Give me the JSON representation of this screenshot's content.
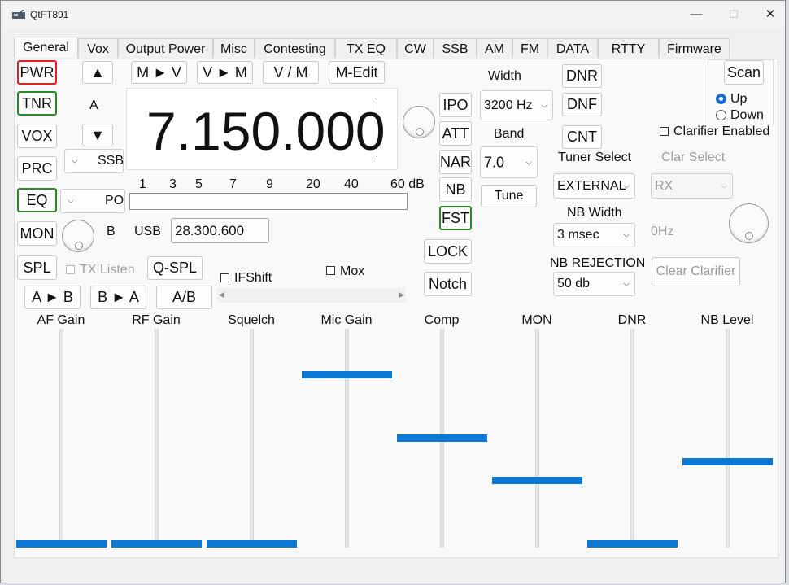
{
  "window": {
    "title": "QtFT891",
    "minimize": "—",
    "maximize": "☐",
    "close": "✕"
  },
  "tabs": [
    "General",
    "Vox",
    "Output Power",
    "Misc",
    "Contesting",
    "TX EQ",
    "CW",
    "SSB",
    "AM",
    "FM",
    "DATA",
    "RTTY",
    "Firmware"
  ],
  "active_tab": "General",
  "left_buttons": {
    "pwr": "PWR",
    "tnr": "TNR",
    "vox": "VOX",
    "prc": "PRC",
    "eq": "EQ",
    "mon": "MON",
    "spl": "SPL"
  },
  "nav": {
    "up": "▲",
    "down": "▼",
    "vfo_label": "A",
    "b_label": "B"
  },
  "mode_combo": {
    "value": "SSB"
  },
  "meter_combo": {
    "value": "PO"
  },
  "memory": {
    "m_to_v": "M ► V",
    "v_to_m": "V ► M",
    "v_m": "V / M",
    "m_edit": "M-Edit"
  },
  "frequency": "7.150.000",
  "meter_scale": [
    "1",
    "3",
    "5",
    "7",
    "9",
    "20",
    "40",
    "60 dB"
  ],
  "vfo_b": {
    "mode": "USB",
    "freq": "28.300.600"
  },
  "tx_listen": "TX Listen",
  "qspl": "Q-SPL",
  "ifshift": "IFShift",
  "mox": "Mox",
  "ab": {
    "a_to_b": "A ► B",
    "b_to_a": "B ► A",
    "swap": "A/B"
  },
  "right_buttons": {
    "ipo": "IPO",
    "att": "ATT",
    "nar": "NAR",
    "nb": "NB",
    "fst": "FST",
    "lock": "LOCK",
    "notch": "Notch",
    "dnr": "DNR",
    "dnf": "DNF",
    "cnt": "CNT"
  },
  "width": {
    "label": "Width",
    "value": "3200 Hz"
  },
  "band": {
    "label": "Band",
    "value": "7.0"
  },
  "tune": "Tune",
  "tuner": {
    "label": "Tuner Select",
    "value": "EXTERNAL"
  },
  "nb_width": {
    "label": "NB Width",
    "value": "3 msec"
  },
  "nb_rejection": {
    "label": "NB REJECTION",
    "value": "50 db"
  },
  "scan": {
    "label": "Scan",
    "up": "Up",
    "down": "Down",
    "selected": "Up"
  },
  "clarifier": {
    "enabled_label": "Clarifier Enabled",
    "select_label": "Clar Select",
    "select_value": "RX",
    "offset": "0Hz",
    "clear": "Clear Clarifier"
  },
  "sliders": [
    {
      "label": "AF Gain",
      "level": 0.0
    },
    {
      "label": "RF Gain",
      "level": 0.0
    },
    {
      "label": "Squelch",
      "level": 0.0
    },
    {
      "label": "Mic Gain",
      "level": 0.8
    },
    {
      "label": "Comp",
      "level": 0.5
    },
    {
      "label": "MON",
      "level": 0.3
    },
    {
      "label": "DNR",
      "level": 0.0
    },
    {
      "label": "NB Level",
      "level": 0.39
    }
  ],
  "colors": {
    "accent": "#0a78d4",
    "pwr_border": "#dd2222",
    "active_border": "#2a8a2a"
  }
}
